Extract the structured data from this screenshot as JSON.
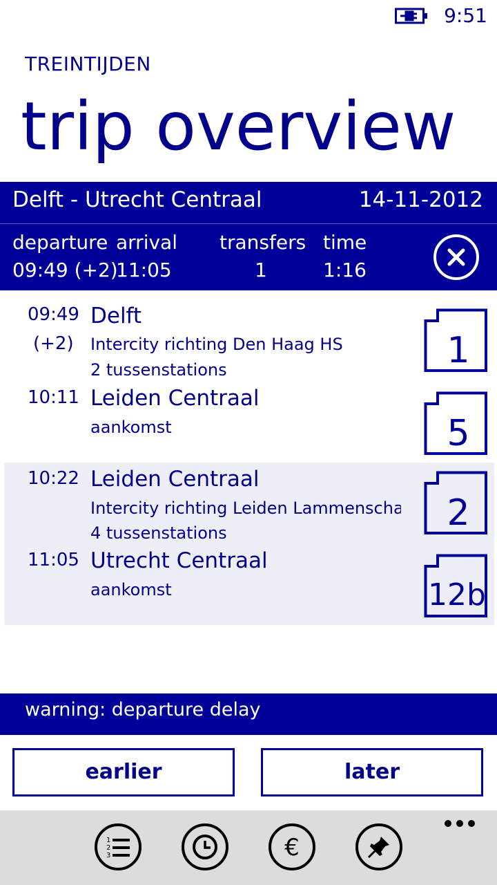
{
  "status": {
    "time": "9:51"
  },
  "app": {
    "name": "TREINTIJDEN",
    "page_title": "trip overview"
  },
  "route": {
    "name": "Delft - Utrecht Centraal",
    "date": "14-11-2012"
  },
  "summary": {
    "departure_label": "departure",
    "departure_value": "09:49 (+2)",
    "arrival_label": "arrival",
    "arrival_value": "11:05",
    "transfers_label": "transfers",
    "transfers_value": "1",
    "time_label": "time",
    "time_value": "1:16"
  },
  "legs": [
    {
      "departure": {
        "time": "09:49",
        "delay": "(+2)",
        "station": "Delft",
        "direction": "Intercity richting Den Haag HS",
        "between": "2 tussenstations",
        "platform": "1"
      },
      "arrival": {
        "time": "10:11",
        "station": "Leiden Centraal",
        "note": "aankomst",
        "platform": "5"
      }
    },
    {
      "departure": {
        "time": "10:22",
        "station": "Leiden Centraal",
        "direction": "Intercity richting Leiden Lammenschans",
        "between": "4 tussenstations",
        "platform": "2"
      },
      "arrival": {
        "time": "11:05",
        "station": "Utrecht Centraal",
        "note": "aankomst",
        "platform": "12b"
      }
    }
  ],
  "warning": "warning: departure delay",
  "buttons": {
    "earlier": "earlier",
    "later": "later"
  },
  "app_bar": {
    "icons": [
      "list-icon",
      "clock-icon",
      "euro-icon",
      "pin-icon",
      "more-icon"
    ]
  },
  "colors": {
    "accent": "#000099",
    "text": "#00008b",
    "app_bar": "#dcdcdc",
    "leg_highlight": "#eeeef7"
  }
}
